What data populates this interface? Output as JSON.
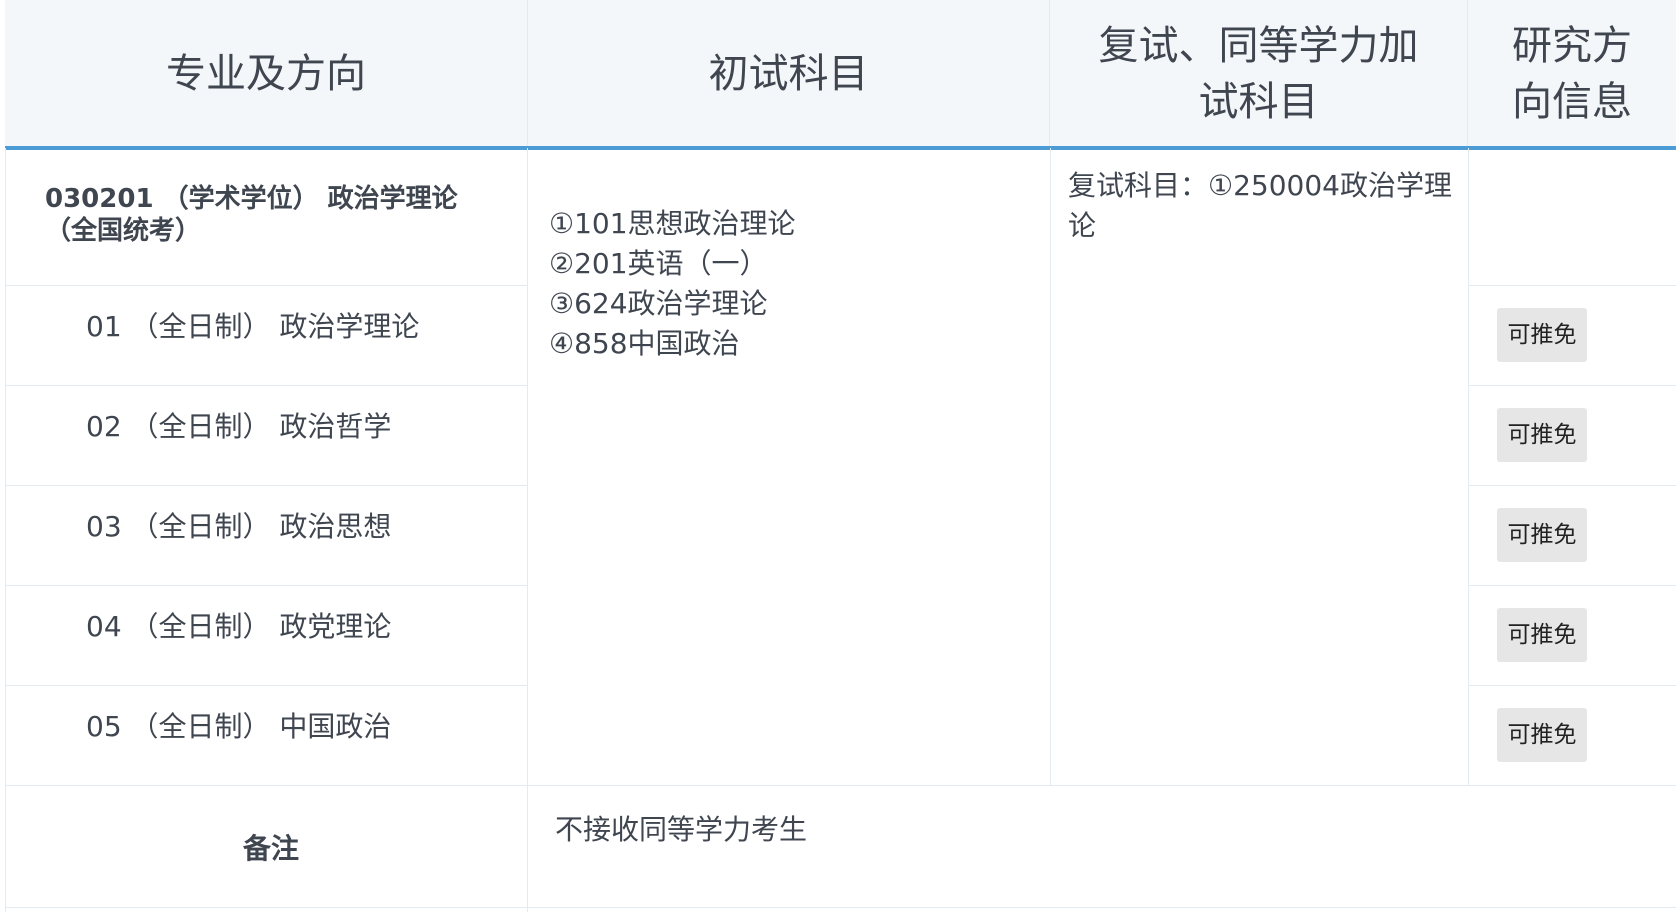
{
  "headers": {
    "major": "专业及方向",
    "initial_subjects": "初试科目",
    "retest_subjects": "复试、同等学力加试科目",
    "research_info": "研究方向信息"
  },
  "major": {
    "title": "030201 （学术学位） 政治学理论（全国统考）"
  },
  "directions": [
    {
      "label": "01 （全日制） 政治学理论",
      "badge": "可推免"
    },
    {
      "label": "02 （全日制） 政治哲学",
      "badge": "可推免"
    },
    {
      "label": "03 （全日制） 政治思想",
      "badge": "可推免"
    },
    {
      "label": "04 （全日制） 政党理论",
      "badge": "可推免"
    },
    {
      "label": "05 （全日制） 中国政治",
      "badge": "可推免"
    }
  ],
  "initial_subjects": [
    "①101思想政治理论",
    "②201英语（一）",
    "③624政治学理论",
    "④858中国政治"
  ],
  "retest": "复试科目：①250004政治学理论",
  "remarks": {
    "label": "备注",
    "text": "不接收同等学力考生"
  }
}
